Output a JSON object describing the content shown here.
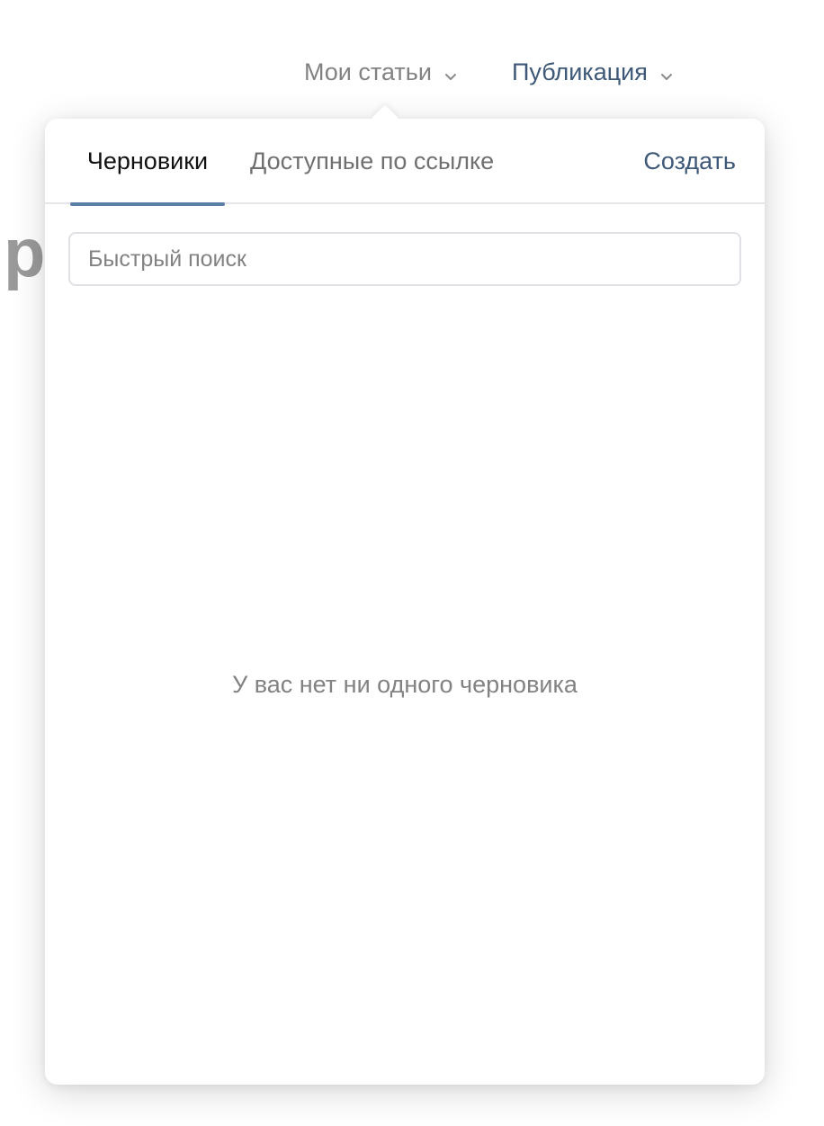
{
  "nav": {
    "my_articles_label": "Мои статьи",
    "publication_label": "Публикация"
  },
  "background": {
    "partial_heading": "р"
  },
  "popover": {
    "tabs": [
      {
        "label": "Черновики",
        "active": true
      },
      {
        "label": "Доступные по ссылке",
        "active": false
      }
    ],
    "create_label": "Создать",
    "search": {
      "placeholder": "Быстрый поиск",
      "value": ""
    },
    "empty_message": "У вас нет ни одного черновика"
  },
  "colors": {
    "accent": "#3e5878",
    "tab_underline": "#5b7ea5",
    "muted_text": "#828282"
  },
  "icons": {
    "dropdown": "chevron-down-icon"
  }
}
